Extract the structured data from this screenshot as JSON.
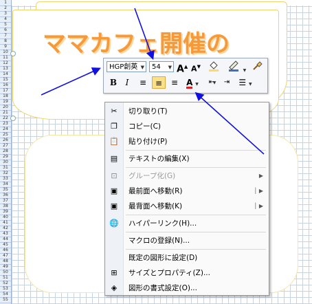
{
  "row_numbers": [
    "1",
    "2",
    "3",
    "4",
    "5",
    "6",
    "7",
    "8",
    "9",
    "10",
    "11",
    "12",
    "13",
    "14",
    "15",
    "16",
    "17",
    "18",
    "19",
    "20",
    "21",
    "22",
    "23",
    "24",
    "25",
    "26",
    "27",
    "28",
    "29",
    "30",
    "31",
    "32",
    "33",
    "34",
    "35",
    "36",
    "37",
    "38",
    "39",
    "40",
    "41",
    "42",
    "43",
    "44",
    "45",
    "46",
    "47",
    "48",
    "49",
    "50",
    "51",
    "52",
    "53",
    "54",
    "55"
  ],
  "shape_text": "ママカフェ開催の",
  "toolbar": {
    "font_name": "HGP創英",
    "font_size": "54",
    "grow_font": "A",
    "shrink_font": "A",
    "bold": "B",
    "italic": "I",
    "font_color_letter": "A"
  },
  "menu": {
    "items": [
      {
        "label": "切り取り(T)",
        "icon": "scissors-icon",
        "enabled": true,
        "submenu": false
      },
      {
        "label": "コピー(C)",
        "icon": "copy-icon",
        "enabled": true,
        "submenu": false
      },
      {
        "label": "貼り付け(P)",
        "icon": "paste-icon",
        "enabled": true,
        "submenu": false
      },
      {
        "label": "テキストの編集(X)",
        "icon": "edit-text-icon",
        "enabled": true,
        "submenu": false
      },
      {
        "label": "グループ化(G)",
        "icon": "group-icon",
        "enabled": false,
        "submenu": true
      },
      {
        "label": "最前面へ移動(R)",
        "icon": "bring-to-front-icon",
        "enabled": true,
        "submenu": true
      },
      {
        "label": "最背面へ移動(K)",
        "icon": "send-to-back-icon",
        "enabled": true,
        "submenu": true
      },
      {
        "label": "ハイパーリンク(H)...",
        "icon": "hyperlink-icon",
        "enabled": true,
        "submenu": false
      },
      {
        "label": "マクロの登録(N)...",
        "icon": "",
        "enabled": true,
        "submenu": false
      },
      {
        "label": "既定の図形に設定(D)",
        "icon": "",
        "enabled": true,
        "submenu": false
      },
      {
        "label": "サイズとプロパティ(Z)...",
        "icon": "size-properties-icon",
        "enabled": true,
        "submenu": false
      },
      {
        "label": "図形の書式設定(O)...",
        "icon": "format-shape-icon",
        "enabled": true,
        "submenu": false
      }
    ]
  },
  "colors": {
    "arrow": "#1010e0",
    "title_text": "#f59a3a",
    "highlight_fill": "#ffd966",
    "font_color_underline": "#e02020"
  }
}
